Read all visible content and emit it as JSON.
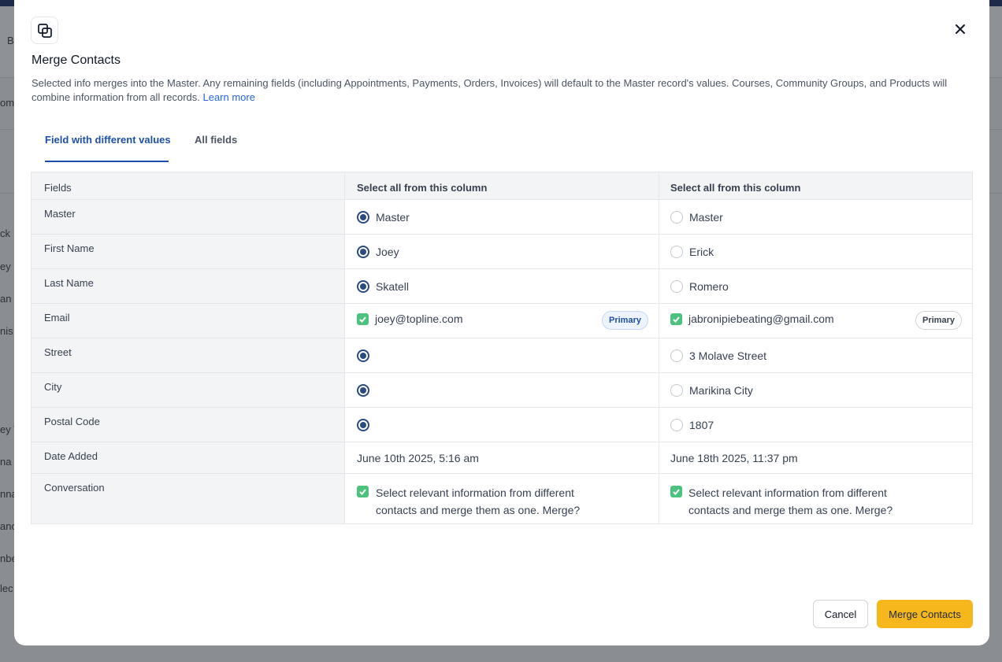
{
  "background": {
    "row_fragments": [
      "B",
      "omp",
      "ck",
      "ey S",
      "an",
      "nis",
      "ey T",
      "na",
      "nna",
      "anc",
      "nbe",
      "lec"
    ]
  },
  "modal": {
    "title": "Merge Contacts",
    "description": "Selected info merges into the Master. Any remaining fields (including Appointments, Payments, Orders, Invoices) will default to the Master record's values. Courses, Community Groups, and Products will combine information from all records.",
    "learn_more": "Learn more",
    "icon": "copy-icon",
    "close_icon": "close-icon"
  },
  "tabs": [
    {
      "label": "Field with different values",
      "active": true
    },
    {
      "label": "All fields",
      "active": false
    }
  ],
  "table": {
    "header": {
      "fields": "Fields",
      "col1": "Select all from this column",
      "col2": "Select all from this column"
    },
    "rows": [
      {
        "field": "Master",
        "type": "radio",
        "c1": {
          "value": "Master",
          "selected": true
        },
        "c2": {
          "value": "Master",
          "selected": false
        }
      },
      {
        "field": "First Name",
        "type": "radio",
        "c1": {
          "value": "Joey",
          "selected": true
        },
        "c2": {
          "value": "Erick",
          "selected": false
        }
      },
      {
        "field": "Last Name",
        "type": "radio",
        "c1": {
          "value": "Skatell",
          "selected": true
        },
        "c2": {
          "value": "Romero",
          "selected": false
        }
      },
      {
        "field": "Email",
        "type": "checkbox",
        "c1": {
          "value": "joey@topline.com",
          "badge": "Primary"
        },
        "c2": {
          "value": "jabronipiebeating@gmail.com",
          "badge": "Primary"
        }
      },
      {
        "field": "Street",
        "type": "radio",
        "c1": {
          "value": "",
          "selected": true
        },
        "c2": {
          "value": "3 Molave Street",
          "selected": false
        }
      },
      {
        "field": "City",
        "type": "radio",
        "c1": {
          "value": "",
          "selected": true
        },
        "c2": {
          "value": "Marikina City",
          "selected": false
        }
      },
      {
        "field": "Postal Code",
        "type": "radio",
        "c1": {
          "value": "",
          "selected": true
        },
        "c2": {
          "value": "1807",
          "selected": false
        }
      },
      {
        "field": "Date Added",
        "type": "text",
        "c1": {
          "value": "June 10th 2025, 5:16 am"
        },
        "c2": {
          "value": "June 18th 2025, 11:37 pm"
        }
      },
      {
        "field": "Conversation",
        "type": "checkbox-multiline",
        "c1": {
          "line1": "Select relevant information from different",
          "line2": "contacts and merge them as one. Merge?"
        },
        "c2": {
          "line1": "Select relevant information from different",
          "line2": "contacts and merge them as one. Merge?"
        }
      }
    ]
  },
  "footer": {
    "cancel": "Cancel",
    "merge": "Merge Contacts"
  },
  "colors": {
    "accent": "#1e4fa8",
    "primary_button": "#f5b71b",
    "check": "#4bc27d",
    "radio": "#2b4a7e"
  }
}
